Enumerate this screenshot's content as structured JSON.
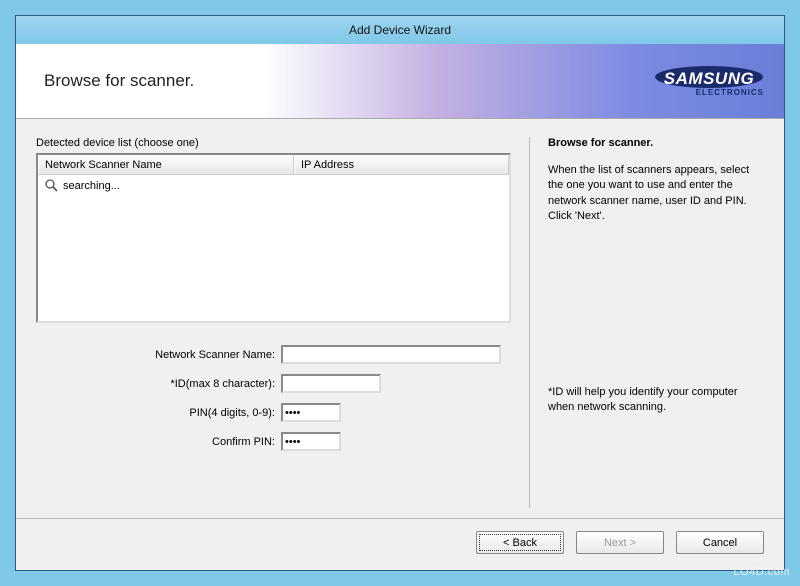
{
  "window": {
    "title": "Add Device Wizard"
  },
  "banner": {
    "heading": "Browse for scanner.",
    "brand_main": "SAMSUNG",
    "brand_sub": "ELECTRONICS"
  },
  "left": {
    "list_caption": "Detected device list (choose one)",
    "columns": {
      "name": "Network Scanner Name",
      "ip": "IP Address"
    },
    "status_text": "searching...",
    "form": {
      "scanner_name_label": "Network Scanner Name:",
      "scanner_name_value": "",
      "id_label": "*ID(max 8 character):",
      "id_value": "",
      "pin_label": "PIN(4 digits, 0-9):",
      "pin_value": "****",
      "confirm_pin_label": "Confirm PIN:",
      "confirm_pin_value": "****"
    }
  },
  "right": {
    "title": "Browse for scanner.",
    "body": "When the list of scanners appears, select the one you want to use and enter the network scanner name, user ID and PIN. Click 'Next'.",
    "note": "*ID will help you identify your computer when network scanning."
  },
  "footer": {
    "back": "< Back",
    "next": "Next >",
    "cancel": "Cancel"
  },
  "watermark": "LO4D.com"
}
